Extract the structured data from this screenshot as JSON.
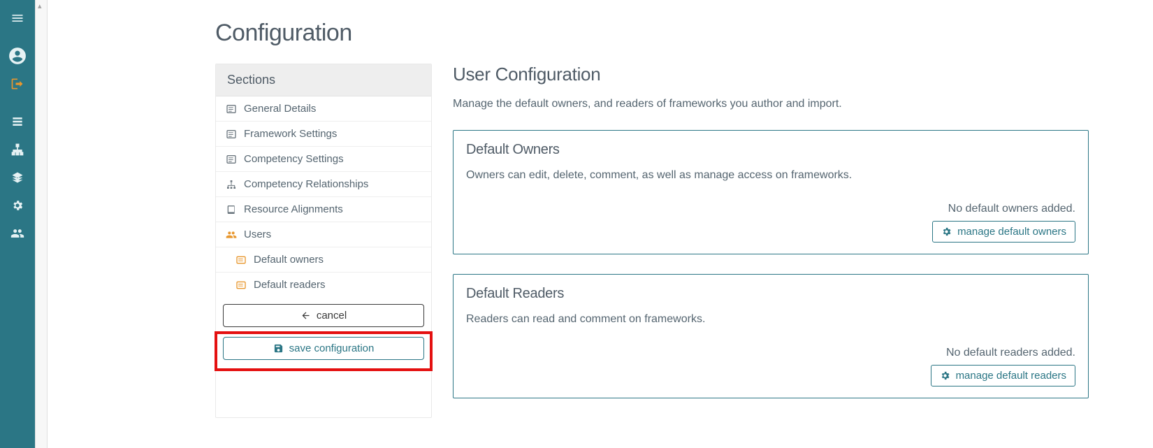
{
  "page_title": "Configuration",
  "sections": {
    "header": "Sections",
    "items": [
      {
        "label": "General Details"
      },
      {
        "label": "Framework Settings"
      },
      {
        "label": "Competency Settings"
      },
      {
        "label": "Competency Relationships"
      },
      {
        "label": "Resource Alignments"
      },
      {
        "label": "Users"
      },
      {
        "label": "Default owners"
      },
      {
        "label": "Default readers"
      }
    ],
    "cancel": "cancel",
    "save": "save configuration"
  },
  "user_config": {
    "title": "User Configuration",
    "description": "Manage the default owners, and readers of frameworks you author and import.",
    "owners": {
      "title": "Default Owners",
      "description": "Owners can edit, delete, comment, as well as manage access on frameworks.",
      "empty": "No default owners added.",
      "button": "manage default owners"
    },
    "readers": {
      "title": "Default Readers",
      "description": "Readers can read and comment on frameworks.",
      "empty": "No default readers added.",
      "button": "manage default readers"
    }
  }
}
